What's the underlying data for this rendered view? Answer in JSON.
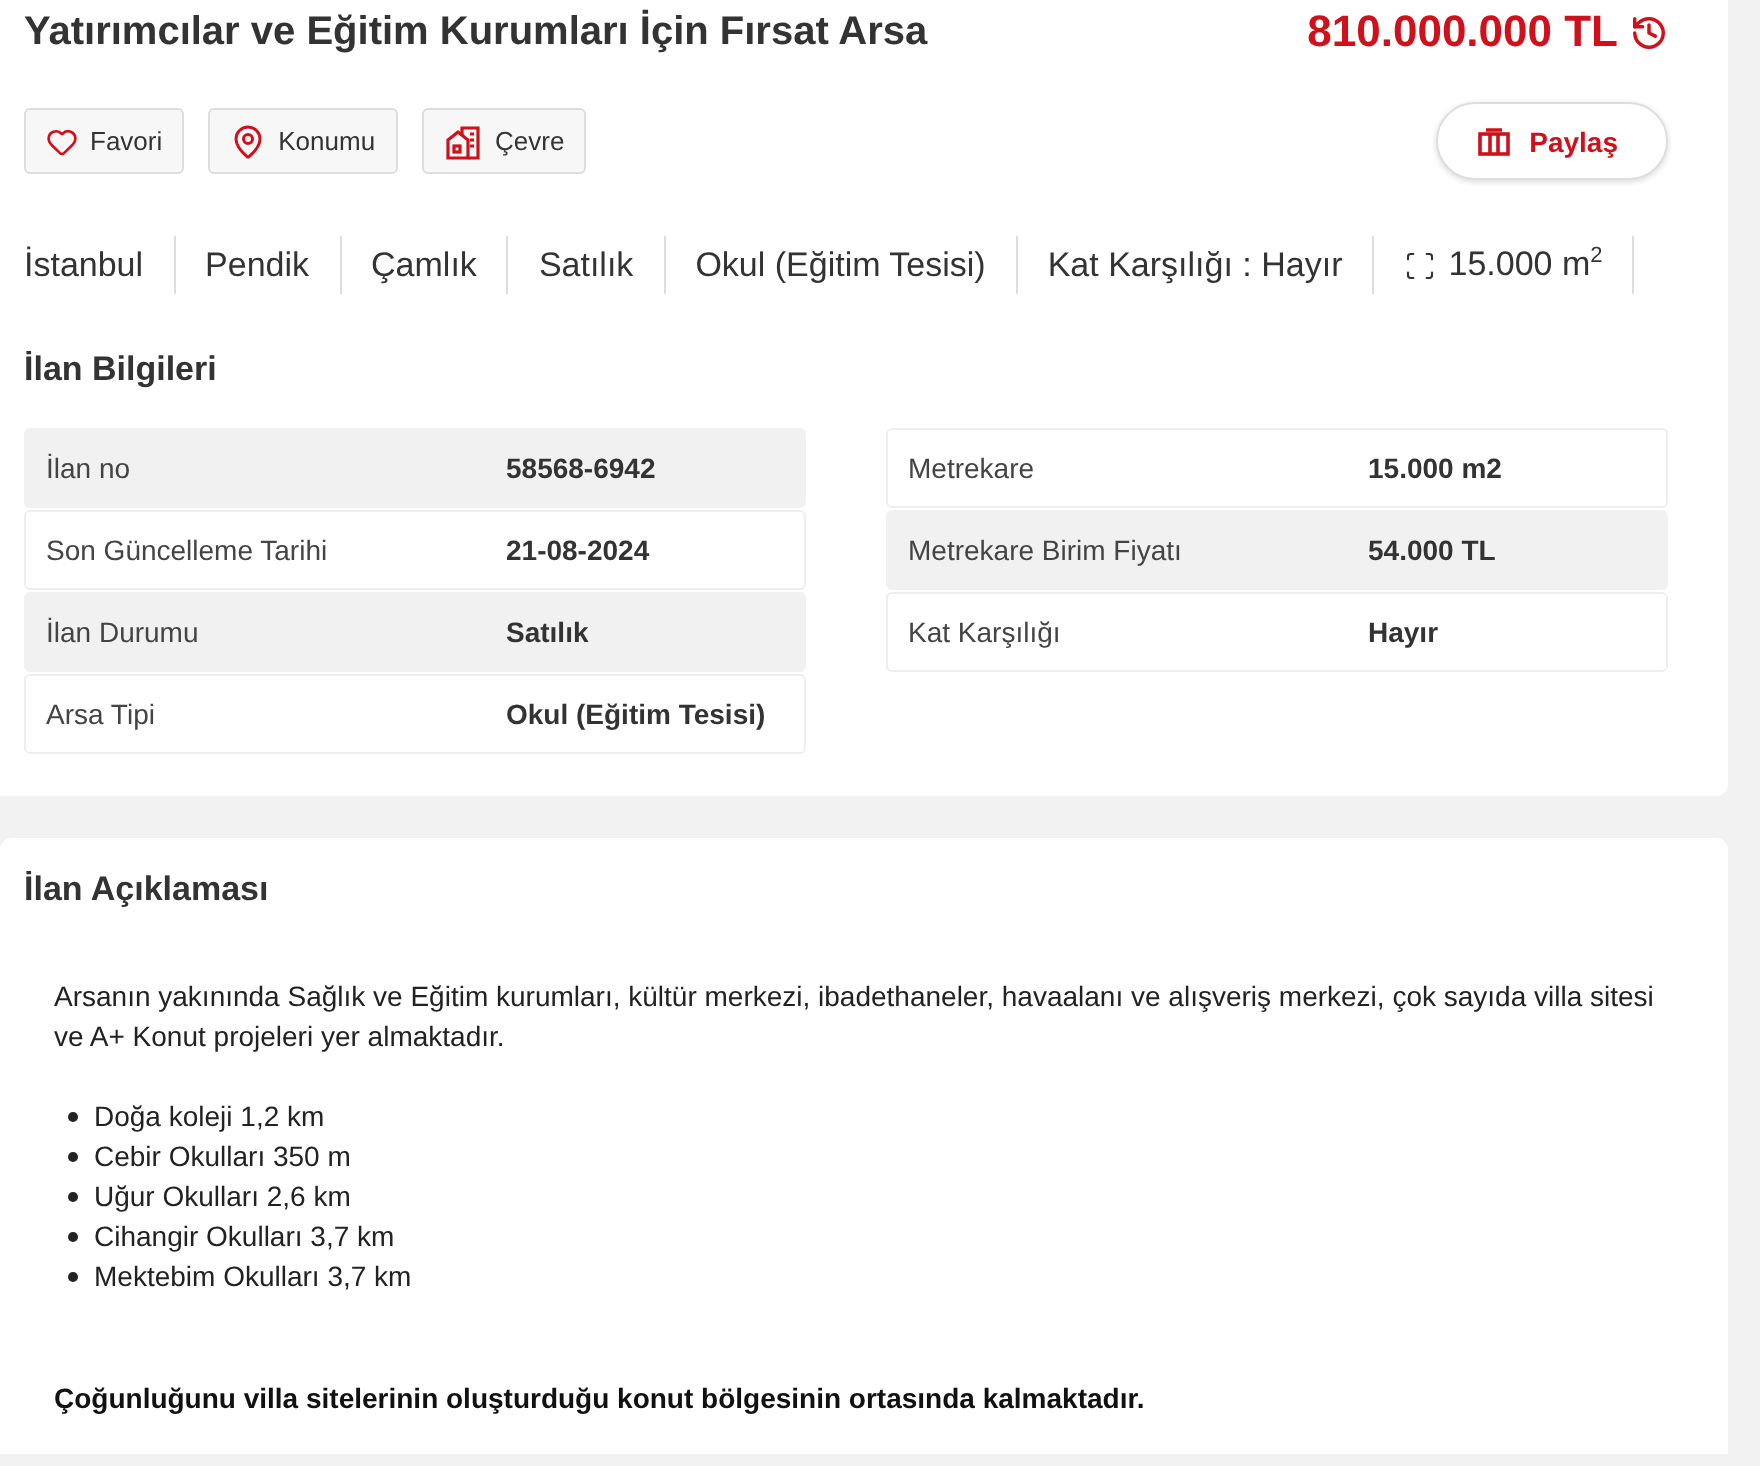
{
  "title": "Yatırımcılar ve Eğitim Kurumları İçin Fırsat Arsa",
  "price": "810.000.000 TL",
  "actions": [
    {
      "kind": "favorite",
      "label": "Favori"
    },
    {
      "kind": "location",
      "label": "Konumu"
    },
    {
      "kind": "surroundings",
      "label": "Çevre"
    }
  ],
  "share": {
    "label": "Paylaş"
  },
  "tags": [
    {
      "kind": "text",
      "label": "İstanbul"
    },
    {
      "kind": "text",
      "label": "Pendik"
    },
    {
      "kind": "text",
      "label": "Çamlık"
    },
    {
      "kind": "text",
      "label": "Satılık"
    },
    {
      "kind": "text",
      "label": "Okul (Eğitim Tesisi)"
    },
    {
      "kind": "text",
      "label": "Kat Karşılığı :  Hayır"
    },
    {
      "kind": "area",
      "label": "15.000 m$^{2}$"
    }
  ],
  "info": {
    "heading": "İlan Bilgileri",
    "left": [
      {
        "label": "İlan no",
        "value": "58568-6942",
        "shaded": true
      },
      {
        "label": "Son Güncelleme Tarihi",
        "value": "21-08-2024",
        "shaded": false
      },
      {
        "label": "İlan Durumu",
        "value": "Satılık",
        "shaded": true
      },
      {
        "label": "Arsa Tipi",
        "value": "Okul (Eğitim Tesisi)",
        "shaded": false
      }
    ],
    "right": [
      {
        "label": "Metrekare",
        "value": "15.000 m2",
        "shaded": false
      },
      {
        "label": "Metrekare Birim Fiyatı",
        "value": "54.000 TL",
        "shaded": true
      },
      {
        "label": "Kat Karşılığı",
        "value": "Hayır",
        "shaded": false
      }
    ]
  },
  "description": {
    "heading": "İlan Açıklaması",
    "paragraph": "Arsanın yakınında Sağlık ve Eğitim kurumları, kültür merkezi, ibadethaneler, havaalanı ve alışveriş merkezi, çok sayıda villa sitesi ve A+ Konut projeleri yer almaktadır.",
    "bullets": [
      "Doğa koleji 1,2 km",
      "Cebir Okulları 350 m",
      "Uğur Okulları 2,6 km",
      "Cihangir Okulları 3,7 km",
      "Mektebim Okulları 3,7 km"
    ],
    "note": "Çoğunluğunu villa sitelerinin oluşturduğu konut bölgesinin ortasında kalmaktadır."
  }
}
